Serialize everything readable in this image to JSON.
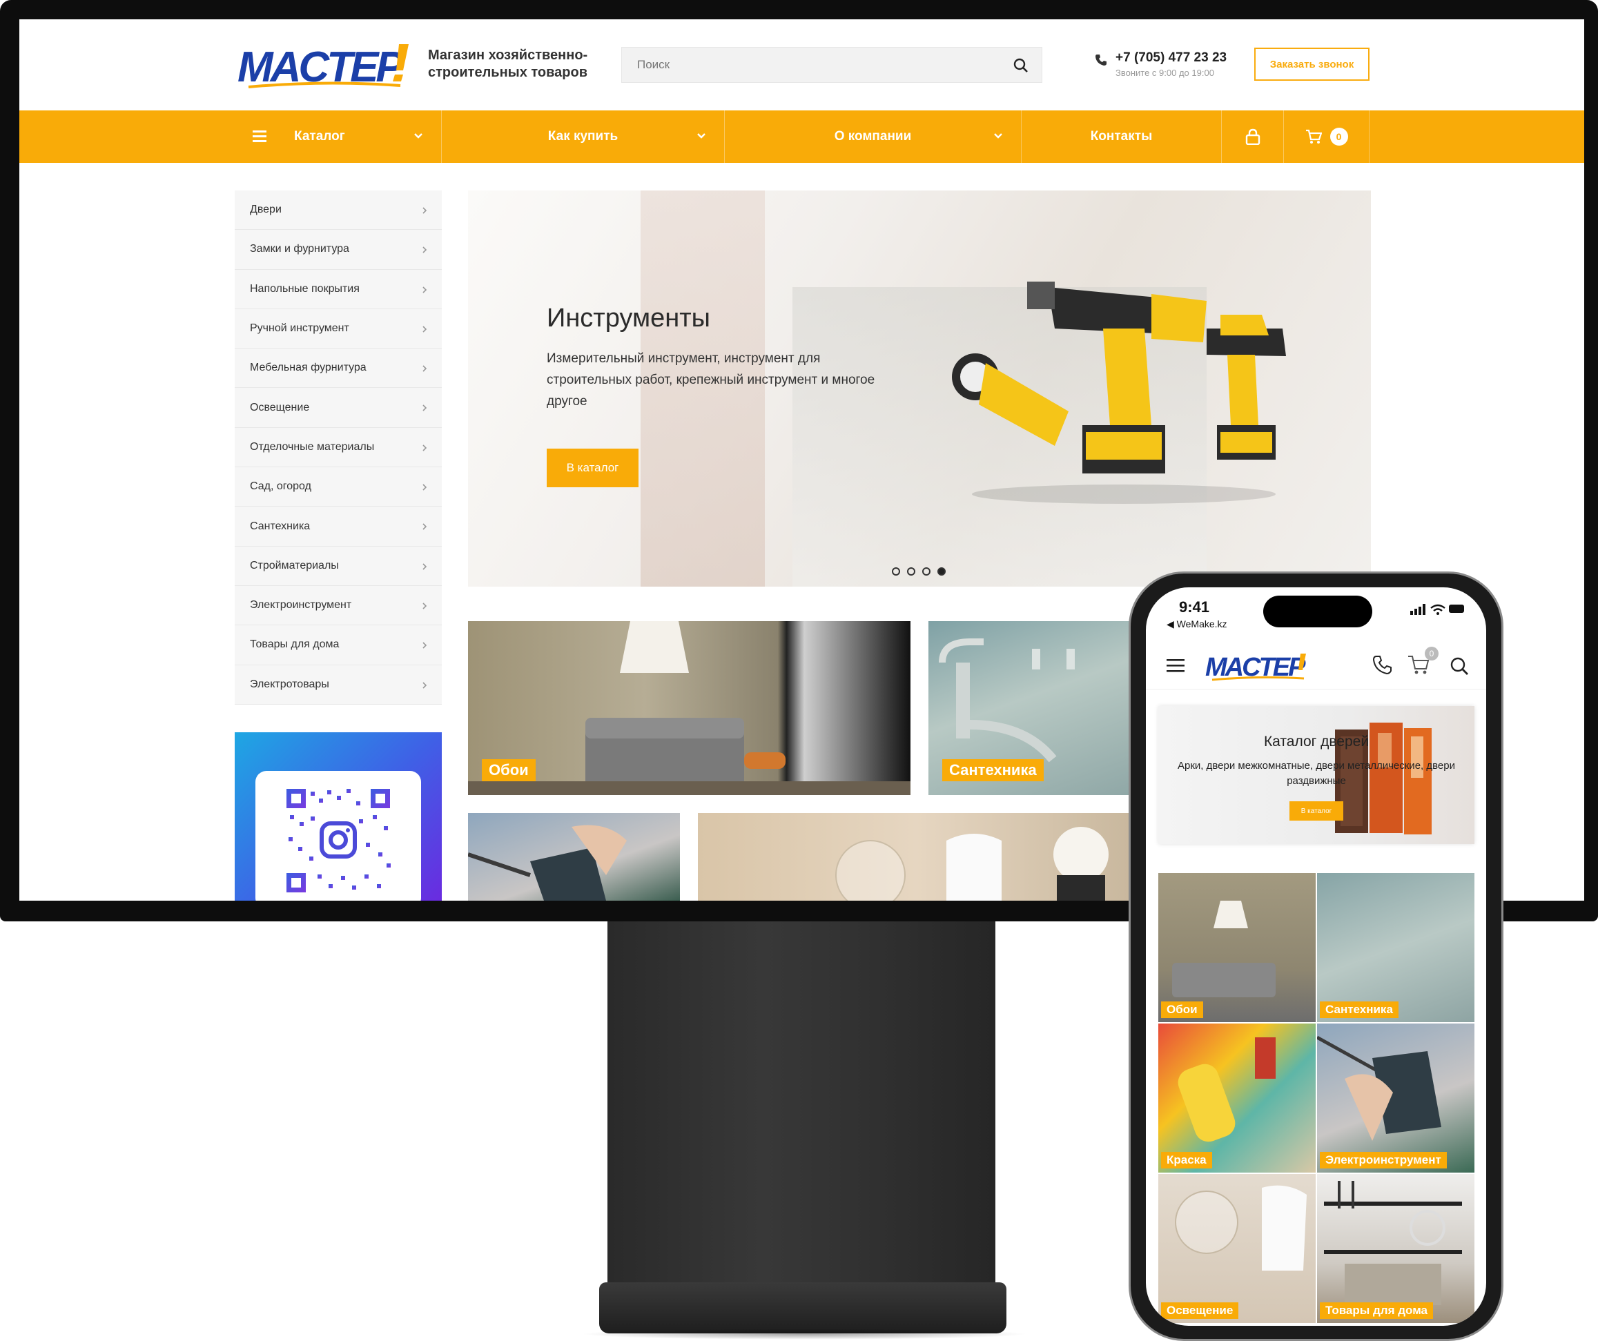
{
  "header": {
    "tagline": "Магазин хозяйственно-строительных товаров",
    "search_placeholder": "Поиск",
    "phone": "+7 (705) 477 23 23",
    "phone_hours": "Звоните с 9:00 до 19:00",
    "callback_label": "Заказать звонок"
  },
  "nav": {
    "catalog": "Каталог",
    "how_to_buy": "Как купить",
    "about": "О компании",
    "contacts": "Контакты",
    "cart_count": "0"
  },
  "sidebar": {
    "items": [
      {
        "label": "Двери"
      },
      {
        "label": "Замки и фурнитура"
      },
      {
        "label": "Напольные покрытия"
      },
      {
        "label": "Ручной инструмент"
      },
      {
        "label": "Мебельная фурнитура"
      },
      {
        "label": "Освещение"
      },
      {
        "label": "Отделочные материалы"
      },
      {
        "label": "Сад, огород"
      },
      {
        "label": "Сантехника"
      },
      {
        "label": "Стройматериалы"
      },
      {
        "label": "Электроинструмент"
      },
      {
        "label": "Товары для дома"
      },
      {
        "label": "Электротовары"
      }
    ]
  },
  "hero": {
    "title": "Инструменты",
    "text": "Измерительный инструмент, инструмент для строительных работ, крепежный инструмент и многое другое",
    "button": "В каталог",
    "slides_total": 4,
    "active_slide": 4
  },
  "tiles": {
    "oboi": "Обои",
    "santehnika": "Сантехника"
  },
  "mobile": {
    "time": "9:41",
    "back_label": "◀ WeMake.kz",
    "cart_count": "0",
    "hero_title": "Каталог дверей",
    "hero_text": "Арки, двери межкомнатные, двери металлические, двери раздвижные",
    "hero_button": "В каталог",
    "tiles": [
      "Обои",
      "Сантехника",
      "Краска",
      "Электроинструмент",
      "Освещение",
      "Товары для дома"
    ]
  },
  "colors": {
    "accent": "#f9ab08",
    "logo_blue": "#1b3fa8"
  }
}
